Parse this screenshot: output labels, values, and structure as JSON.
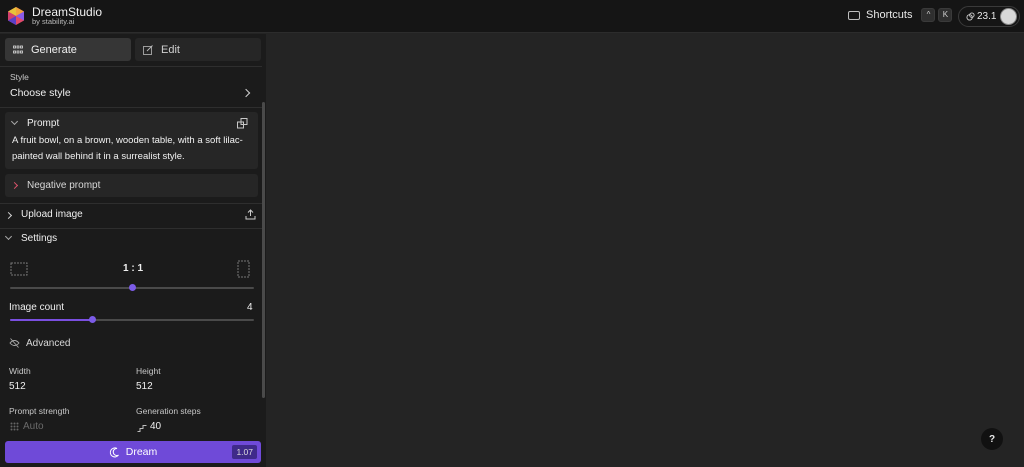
{
  "app": {
    "name": "DreamStudio",
    "by": "by stability.ai"
  },
  "header": {
    "shortcuts_label": "Shortcuts",
    "shortcut_keys": [
      "^",
      "K"
    ],
    "credits": "23.1"
  },
  "tabs": {
    "generate": "Generate",
    "edit": "Edit"
  },
  "style": {
    "label": "Style",
    "value": "Choose style"
  },
  "prompt": {
    "label": "Prompt",
    "text": "A fruit bowl, on a brown, wooden table, with a soft lilac-painted wall behind it in a surrealist style."
  },
  "negative_prompt": {
    "label": "Negative prompt"
  },
  "upload": {
    "label": "Upload image"
  },
  "settings": {
    "label": "Settings",
    "aspect_ratio": "1 : 1",
    "aspect_ratio_position": 0.5,
    "image_count_label": "Image count",
    "image_count": "4",
    "image_count_position": 0.34,
    "advanced_label": "Advanced",
    "width_label": "Width",
    "width": "512",
    "height_label": "Height",
    "height": "512",
    "prompt_strength_label": "Prompt strength",
    "prompt_strength": "Auto",
    "steps_label": "Generation steps",
    "steps": "40"
  },
  "dream": {
    "label": "Dream",
    "cost": "1.07"
  },
  "help": {
    "label": "?"
  },
  "colors": {
    "accent": "#6f4ad8",
    "slider": "#7c5ce8",
    "sidebar": "#1b1b1b",
    "canvas": "#242424"
  }
}
